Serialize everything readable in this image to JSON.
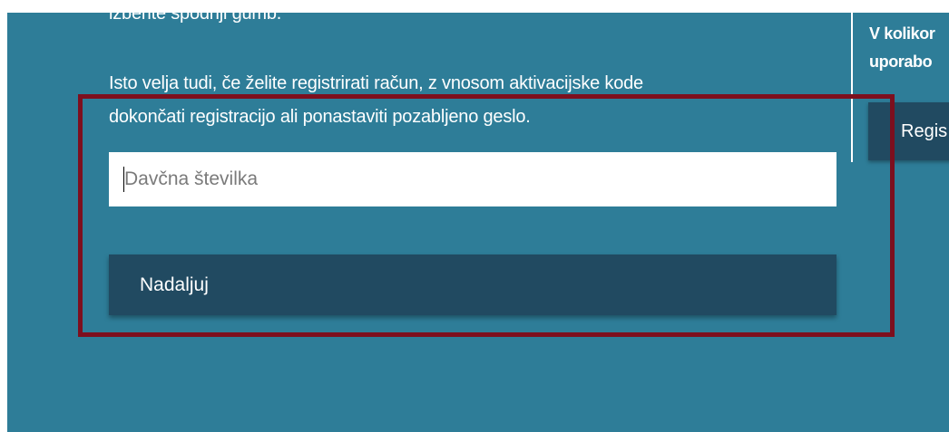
{
  "content": {
    "cutoff_line": "izberite spodnji gumb.",
    "intro_line_1": "Isto velja tudi, če želite registrirati račun, z vnosom aktivacijske kode",
    "intro_line_2": "dokončati registracijo ali ponastaviti pozabljeno geslo."
  },
  "sidebar": {
    "line_1": "V kolikor",
    "line_2": "uporabo",
    "button_label": "Regis"
  },
  "form": {
    "tax_number": {
      "value": "",
      "placeholder": "Davčna številka"
    },
    "continue_label": "Nadaljuj"
  },
  "colors": {
    "panel_bg": "#2e7d98",
    "button_bg": "#214a61",
    "highlight_border": "#7d0f1e"
  }
}
